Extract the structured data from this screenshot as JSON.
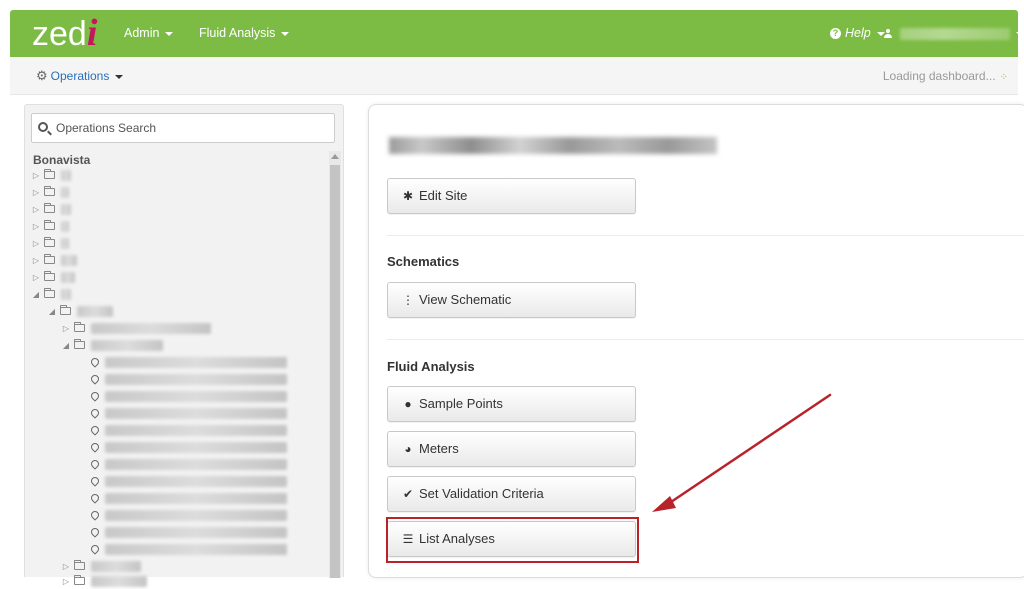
{
  "navbar": {
    "logo_main": "zed",
    "logo_i": "i",
    "menu_admin": "Admin",
    "menu_fluid": "Fluid Analysis",
    "help": "Help",
    "user": ""
  },
  "subbar": {
    "operations_label": "Operations",
    "status": "Loading dashboard..."
  },
  "sidebar": {
    "search_placeholder": "Operations Search",
    "root": "Bonavista"
  },
  "main": {
    "edit_site": "Edit Site",
    "schematics_title": "Schematics",
    "view_schematic": "View Schematic",
    "fluid_title": "Fluid Analysis",
    "sample_points": "Sample Points",
    "meters": "Meters",
    "set_validation": "Set Validation Criteria",
    "list_analyses": "List Analyses"
  },
  "colors": {
    "navbar": "#7cbc44",
    "logo_accent": "#c2185b",
    "link": "#2a6ebb",
    "highlight": "#b8232a"
  },
  "icons": {
    "edit_site": "gear-icon",
    "view_schematic": "sitemap-icon",
    "sample_points": "map-marker-icon",
    "meters": "dashboard-icon",
    "set_validation": "check-icon",
    "list_analyses": "list-icon"
  }
}
